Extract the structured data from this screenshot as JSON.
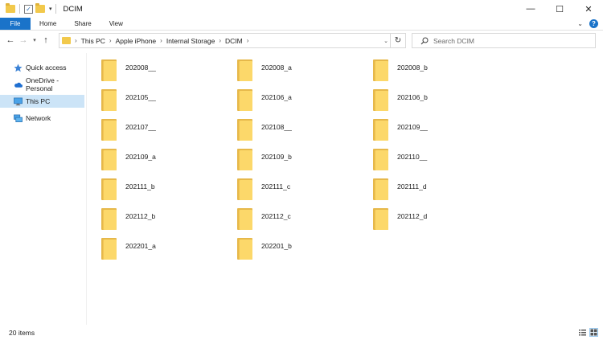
{
  "window": {
    "title": "DCIM",
    "controls": {
      "minimize": "—",
      "maximize": "☐",
      "close": "✕"
    }
  },
  "ribbon": {
    "tabs": [
      {
        "label": "File",
        "active": true
      },
      {
        "label": "Home"
      },
      {
        "label": "Share"
      },
      {
        "label": "View"
      }
    ],
    "accent": "#1a73c9"
  },
  "address": {
    "breadcrumb": [
      "This PC",
      "Apple iPhone",
      "Internal Storage",
      "DCIM"
    ]
  },
  "search": {
    "placeholder": "Search DCIM"
  },
  "nav": {
    "items": [
      {
        "label": "Quick access",
        "icon": "star-icon",
        "selected": false
      },
      {
        "label": "OneDrive - Personal",
        "icon": "cloud-icon",
        "selected": false
      },
      {
        "label": "This PC",
        "icon": "pc-icon",
        "selected": true
      },
      {
        "label": "Network",
        "icon": "network-icon",
        "selected": false
      }
    ]
  },
  "folders": [
    "202008__",
    "202008_a",
    "202008_b",
    "202105__",
    "202106_a",
    "202106_b",
    "202107__",
    "202108__",
    "202109__",
    "202109_a",
    "202109_b",
    "202110__",
    "202111_b",
    "202111_c",
    "202111_d",
    "202112_b",
    "202112_c",
    "202112_d",
    "202201_a",
    "202201_b"
  ],
  "status": {
    "item_count": "20 items"
  }
}
